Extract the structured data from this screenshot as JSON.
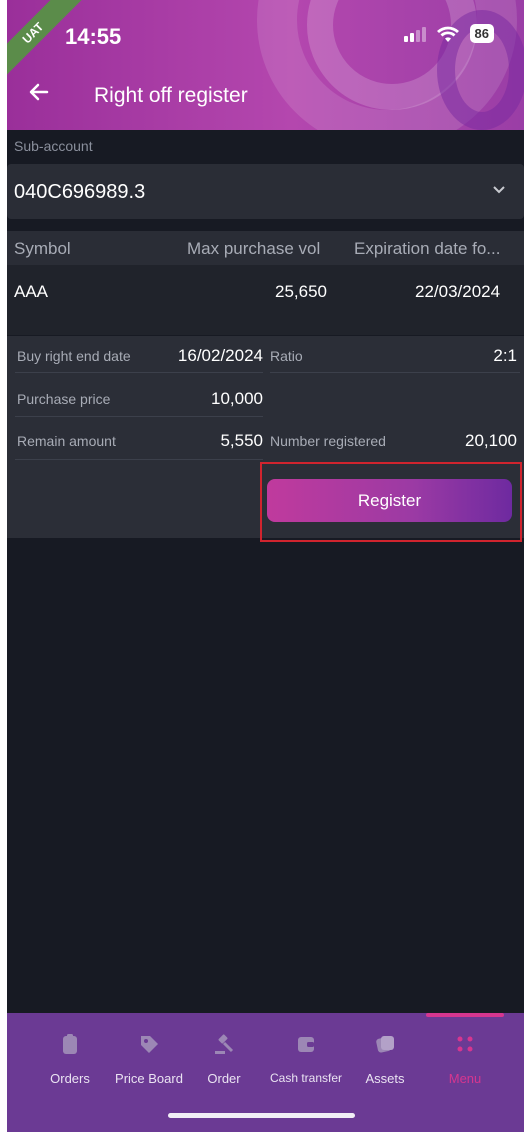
{
  "status_bar": {
    "env_badge": "UAT",
    "time": "14:55",
    "battery": "86"
  },
  "header": {
    "back_icon": "arrow-left-icon",
    "title": "Right off register"
  },
  "sub_account": {
    "label": "Sub-account",
    "value": "040C696989.3"
  },
  "table": {
    "headers": [
      "Symbol",
      "Max purchase vol",
      "Expiration date fo..."
    ],
    "rows": [
      {
        "symbol": "AAA",
        "max_purchase_vol": "25,650",
        "expiration_date": "22/03/2024"
      }
    ]
  },
  "details": {
    "buy_right_end_date_label": "Buy right end date",
    "buy_right_end_date": "16/02/2024",
    "ratio_label": "Ratio",
    "ratio": "2:1",
    "purchase_price_label": "Purchase price",
    "purchase_price": "10,000",
    "remain_amount_label": "Remain amount",
    "remain_amount": "5,550",
    "number_registered_label": "Number registered",
    "number_registered": "20,100"
  },
  "register_button": "Register",
  "bottom_nav": [
    {
      "label": "Orders",
      "icon": "clipboard-icon"
    },
    {
      "label": "Price Board",
      "icon": "tag-icon"
    },
    {
      "label": "Order",
      "icon": "gavel-icon"
    },
    {
      "label": "Cash transfer",
      "icon": "wallet-icon"
    },
    {
      "label": "Assets",
      "icon": "assets-icon"
    },
    {
      "label": "Menu",
      "icon": "grid-icon",
      "active": true
    }
  ],
  "colors": {
    "accent": "#d6368f",
    "background": "#171a23",
    "header": "#b447ae",
    "nav": "#6b3a94"
  }
}
